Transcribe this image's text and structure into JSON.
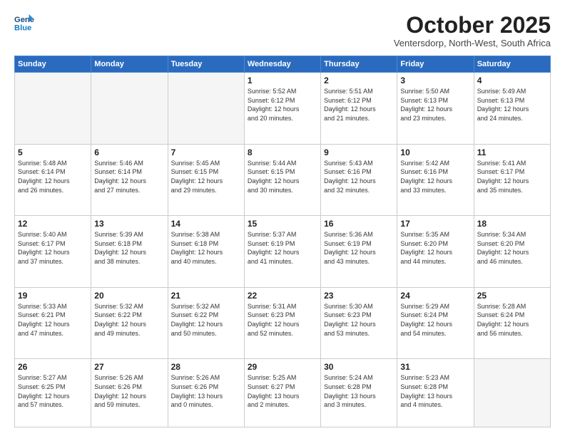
{
  "header": {
    "logo_line1": "General",
    "logo_line2": "Blue",
    "month_title": "October 2025",
    "location": "Ventersdorp, North-West, South Africa"
  },
  "days_of_week": [
    "Sunday",
    "Monday",
    "Tuesday",
    "Wednesday",
    "Thursday",
    "Friday",
    "Saturday"
  ],
  "weeks": [
    [
      {
        "day": "",
        "info": ""
      },
      {
        "day": "",
        "info": ""
      },
      {
        "day": "",
        "info": ""
      },
      {
        "day": "1",
        "info": "Sunrise: 5:52 AM\nSunset: 6:12 PM\nDaylight: 12 hours\nand 20 minutes."
      },
      {
        "day": "2",
        "info": "Sunrise: 5:51 AM\nSunset: 6:12 PM\nDaylight: 12 hours\nand 21 minutes."
      },
      {
        "day": "3",
        "info": "Sunrise: 5:50 AM\nSunset: 6:13 PM\nDaylight: 12 hours\nand 23 minutes."
      },
      {
        "day": "4",
        "info": "Sunrise: 5:49 AM\nSunset: 6:13 PM\nDaylight: 12 hours\nand 24 minutes."
      }
    ],
    [
      {
        "day": "5",
        "info": "Sunrise: 5:48 AM\nSunset: 6:14 PM\nDaylight: 12 hours\nand 26 minutes."
      },
      {
        "day": "6",
        "info": "Sunrise: 5:46 AM\nSunset: 6:14 PM\nDaylight: 12 hours\nand 27 minutes."
      },
      {
        "day": "7",
        "info": "Sunrise: 5:45 AM\nSunset: 6:15 PM\nDaylight: 12 hours\nand 29 minutes."
      },
      {
        "day": "8",
        "info": "Sunrise: 5:44 AM\nSunset: 6:15 PM\nDaylight: 12 hours\nand 30 minutes."
      },
      {
        "day": "9",
        "info": "Sunrise: 5:43 AM\nSunset: 6:16 PM\nDaylight: 12 hours\nand 32 minutes."
      },
      {
        "day": "10",
        "info": "Sunrise: 5:42 AM\nSunset: 6:16 PM\nDaylight: 12 hours\nand 33 minutes."
      },
      {
        "day": "11",
        "info": "Sunrise: 5:41 AM\nSunset: 6:17 PM\nDaylight: 12 hours\nand 35 minutes."
      }
    ],
    [
      {
        "day": "12",
        "info": "Sunrise: 5:40 AM\nSunset: 6:17 PM\nDaylight: 12 hours\nand 37 minutes."
      },
      {
        "day": "13",
        "info": "Sunrise: 5:39 AM\nSunset: 6:18 PM\nDaylight: 12 hours\nand 38 minutes."
      },
      {
        "day": "14",
        "info": "Sunrise: 5:38 AM\nSunset: 6:18 PM\nDaylight: 12 hours\nand 40 minutes."
      },
      {
        "day": "15",
        "info": "Sunrise: 5:37 AM\nSunset: 6:19 PM\nDaylight: 12 hours\nand 41 minutes."
      },
      {
        "day": "16",
        "info": "Sunrise: 5:36 AM\nSunset: 6:19 PM\nDaylight: 12 hours\nand 43 minutes."
      },
      {
        "day": "17",
        "info": "Sunrise: 5:35 AM\nSunset: 6:20 PM\nDaylight: 12 hours\nand 44 minutes."
      },
      {
        "day": "18",
        "info": "Sunrise: 5:34 AM\nSunset: 6:20 PM\nDaylight: 12 hours\nand 46 minutes."
      }
    ],
    [
      {
        "day": "19",
        "info": "Sunrise: 5:33 AM\nSunset: 6:21 PM\nDaylight: 12 hours\nand 47 minutes."
      },
      {
        "day": "20",
        "info": "Sunrise: 5:32 AM\nSunset: 6:22 PM\nDaylight: 12 hours\nand 49 minutes."
      },
      {
        "day": "21",
        "info": "Sunrise: 5:32 AM\nSunset: 6:22 PM\nDaylight: 12 hours\nand 50 minutes."
      },
      {
        "day": "22",
        "info": "Sunrise: 5:31 AM\nSunset: 6:23 PM\nDaylight: 12 hours\nand 52 minutes."
      },
      {
        "day": "23",
        "info": "Sunrise: 5:30 AM\nSunset: 6:23 PM\nDaylight: 12 hours\nand 53 minutes."
      },
      {
        "day": "24",
        "info": "Sunrise: 5:29 AM\nSunset: 6:24 PM\nDaylight: 12 hours\nand 54 minutes."
      },
      {
        "day": "25",
        "info": "Sunrise: 5:28 AM\nSunset: 6:24 PM\nDaylight: 12 hours\nand 56 minutes."
      }
    ],
    [
      {
        "day": "26",
        "info": "Sunrise: 5:27 AM\nSunset: 6:25 PM\nDaylight: 12 hours\nand 57 minutes."
      },
      {
        "day": "27",
        "info": "Sunrise: 5:26 AM\nSunset: 6:26 PM\nDaylight: 12 hours\nand 59 minutes."
      },
      {
        "day": "28",
        "info": "Sunrise: 5:26 AM\nSunset: 6:26 PM\nDaylight: 13 hours\nand 0 minutes."
      },
      {
        "day": "29",
        "info": "Sunrise: 5:25 AM\nSunset: 6:27 PM\nDaylight: 13 hours\nand 2 minutes."
      },
      {
        "day": "30",
        "info": "Sunrise: 5:24 AM\nSunset: 6:28 PM\nDaylight: 13 hours\nand 3 minutes."
      },
      {
        "day": "31",
        "info": "Sunrise: 5:23 AM\nSunset: 6:28 PM\nDaylight: 13 hours\nand 4 minutes."
      },
      {
        "day": "",
        "info": ""
      }
    ]
  ]
}
